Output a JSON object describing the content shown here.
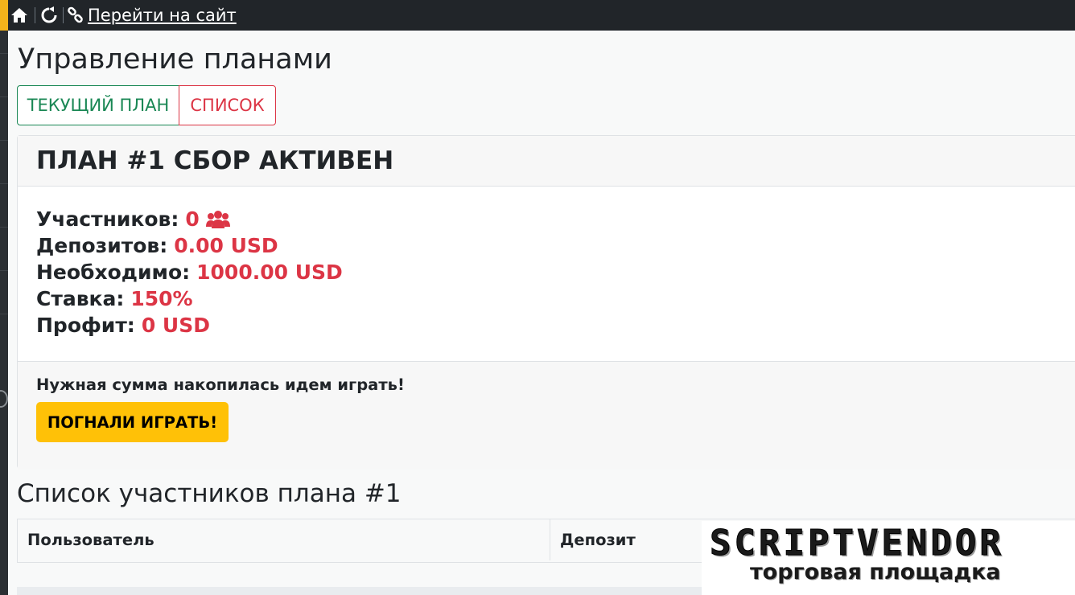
{
  "topbar": {
    "icons": [
      "home-icon",
      "refresh-icon",
      "link-icon"
    ],
    "goto_site_label": "Перейти на сайт"
  },
  "page": {
    "title": "Управление планами"
  },
  "tabs": [
    {
      "label": "ТЕКУЩИЙ ПЛАН",
      "color": "#198754"
    },
    {
      "label": "СПИСОК",
      "color": "#dc3545"
    }
  ],
  "plan": {
    "title": "ПЛАН #1 СБОР АКТИВЕН",
    "stats": [
      {
        "label": "Участников:",
        "value": "0"
      },
      {
        "label": "Депозитов:",
        "value": "0.00 USD"
      },
      {
        "label": "Необходимо:",
        "value": "1000.00 USD"
      },
      {
        "label": "Ставка:",
        "value": "150%"
      },
      {
        "label": "Профит:",
        "value": "0 USD"
      }
    ],
    "footer_message": "Нужная сумма накопилась идем играть!",
    "play_button_label": "ПОГНАЛИ ИГРАТЬ!"
  },
  "participants": {
    "title": "Список участников плана #1",
    "columns": [
      "Пользователь",
      "Депозит"
    ]
  },
  "watermark": {
    "brand": "SCRIPTVENDOR",
    "tagline": "торговая площадка"
  },
  "colors": {
    "accent": "#ffc107",
    "value_red": "#dc3545",
    "success_green": "#198754",
    "topbar_bg": "#212529"
  }
}
